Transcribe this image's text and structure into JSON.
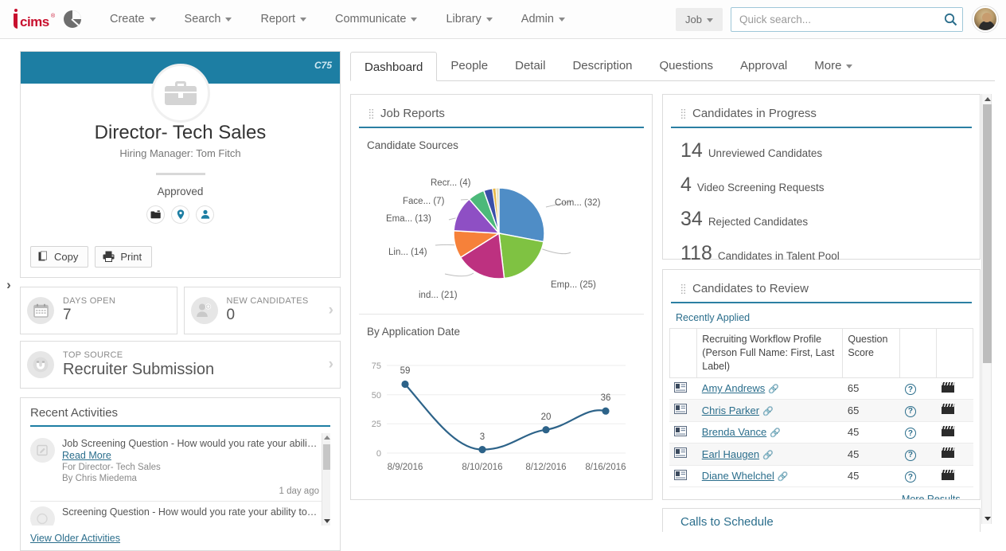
{
  "topnav": {
    "logo_text": "cims",
    "logo_tm": "®",
    "app_icon": "pie-chart-icon",
    "menu": [
      {
        "label": "Create",
        "caret": true
      },
      {
        "label": "Search",
        "caret": true
      },
      {
        "label": "Report",
        "caret": true
      },
      {
        "label": "Communicate",
        "caret": true
      },
      {
        "label": "Library",
        "caret": true
      },
      {
        "label": "Admin",
        "caret": true
      }
    ],
    "scope_selector": "Job",
    "search_placeholder": "Quick search...",
    "search_value": ""
  },
  "job_card": {
    "code": "C75",
    "title": "Director- Tech Sales",
    "subtitle": "Hiring Manager: Tom Fitch",
    "status": "Approved",
    "quick_icons": [
      "folder-icon",
      "location-pin-icon",
      "person-icon"
    ],
    "actions": [
      {
        "label": "Copy",
        "icon": "copy-icon"
      },
      {
        "label": "Print",
        "icon": "printer-icon"
      }
    ]
  },
  "stats": [
    {
      "label": "DAYS OPEN",
      "value": "7",
      "icon": "calendar-icon",
      "chevron": false
    },
    {
      "label": "NEW CANDIDATES",
      "value": "0",
      "icon": "new-candidate-icon",
      "chevron": true
    }
  ],
  "top_source": {
    "label": "TOP SOURCE",
    "value": "Recruiter Submission",
    "icon": "magnet-icon"
  },
  "recent_activities": {
    "title": "Recent Activities",
    "items": [
      {
        "text": "Job Screening Question - How would you rate your ability to ...",
        "read_more": "Read More",
        "for": "For Director- Tech Sales",
        "by": "By Chris Miedema",
        "time": "1 day ago"
      },
      {
        "text": "Screening Question - How would you rate your ability to ana...",
        "read_more": "",
        "for": "",
        "by": "",
        "time": ""
      }
    ],
    "view_older": "View Older Activities"
  },
  "tabs": [
    {
      "label": "Dashboard",
      "active": true,
      "caret": false
    },
    {
      "label": "People",
      "active": false,
      "caret": false
    },
    {
      "label": "Detail",
      "active": false,
      "caret": false
    },
    {
      "label": "Description",
      "active": false,
      "caret": false
    },
    {
      "label": "Questions",
      "active": false,
      "caret": false
    },
    {
      "label": "Approval",
      "active": false,
      "caret": false
    },
    {
      "label": "More",
      "active": false,
      "caret": true
    }
  ],
  "job_reports": {
    "title": "Job Reports"
  },
  "candidates_in_progress": {
    "title": "Candidates in Progress",
    "rows": [
      {
        "count": "14",
        "label": "Unreviewed Candidates"
      },
      {
        "count": "4",
        "label": "Video Screening Requests"
      },
      {
        "count": "34",
        "label": "Rejected Candidates"
      },
      {
        "count": "118",
        "label": "Candidates in Talent Pool"
      }
    ]
  },
  "candidates_to_review": {
    "title": "Candidates to Review",
    "subtab": "Recently Applied",
    "columns": [
      "",
      "Recruiting Workflow Profile (Person Full Name: First, Last Label)",
      "Question Score",
      "",
      ""
    ],
    "rows": [
      {
        "name": "Amy Andrews",
        "score": "65"
      },
      {
        "name": "Chris Parker",
        "score": "65"
      },
      {
        "name": "Brenda Vance",
        "score": "45"
      },
      {
        "name": "Earl Haugen",
        "score": "45"
      },
      {
        "name": "Diane Whelchel",
        "score": "45"
      }
    ],
    "more_results": "More Results..."
  },
  "calls_to_schedule": {
    "title": "Calls to Schedule"
  },
  "colors": {
    "accent": "#1d7ea3",
    "link": "#2b6e8c",
    "brand_red": "#c8102e",
    "banner": "#1d7ea3"
  },
  "chart_data": [
    {
      "type": "pie",
      "title": "Candidate Sources",
      "labels": [
        "Com... (32)",
        "Emp... (25)",
        "ind... (21)",
        "Lin... (14)",
        "Ema... (13)",
        "Face... (7)",
        "Recr... (4)"
      ],
      "categories": [
        "Com...",
        "Emp...",
        "ind...",
        "Lin...",
        "Ema...",
        "Face...",
        "Recr..."
      ],
      "values": [
        32,
        25,
        21,
        14,
        13,
        7,
        4
      ],
      "colors": [
        "#4f8dc6",
        "#7fc242",
        "#bd3180",
        "#f6813a",
        "#8e4fc4",
        "#4cb97a",
        "#3b4fa8"
      ],
      "legend": "labels-outside"
    },
    {
      "type": "line",
      "title": "By Application Date",
      "x": [
        "8/9/2016",
        "8/10/2016",
        "8/12/2016",
        "8/16/2016"
      ],
      "values": [
        59,
        3,
        20,
        36
      ],
      "point_labels": [
        "59",
        "3",
        "20",
        "36"
      ],
      "yticks": [
        "0",
        "25",
        "50",
        "75"
      ],
      "ylim": [
        0,
        75
      ],
      "xlabel": "",
      "ylabel": "",
      "grid": true,
      "series_color": "#2d6389"
    }
  ]
}
